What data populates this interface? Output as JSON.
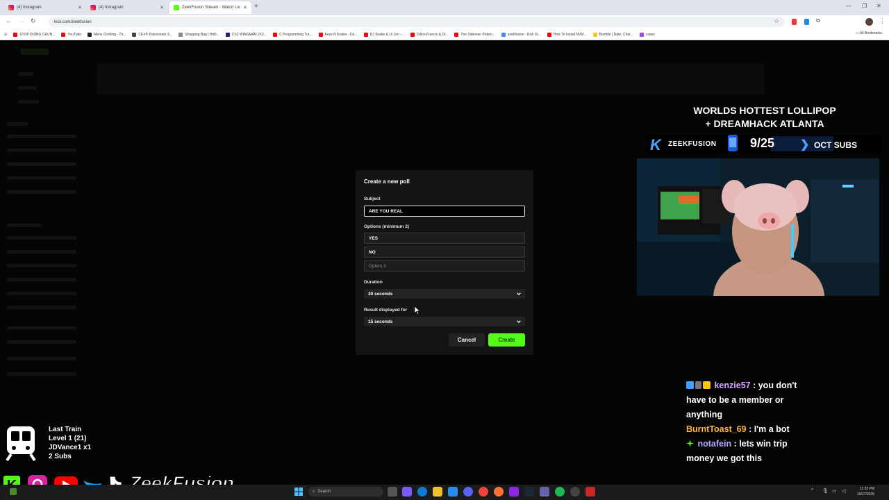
{
  "browser": {
    "tabs": [
      {
        "label": "(4) Instagram",
        "active": false
      },
      {
        "label": "(4) Instagram",
        "active": false
      },
      {
        "label": "ZeekFusion Stream - Watch Liv",
        "active": true
      }
    ],
    "url": "kick.com/zeekfusion",
    "bookmarks": [
      {
        "label": "STOP DOING CRUN...",
        "color": "#ff0000"
      },
      {
        "label": "YouTube",
        "color": "#ff0000"
      },
      {
        "label": "Mens Clothing - Th...",
        "color": "#222222"
      },
      {
        "label": "CEV® Passionate S...",
        "color": "#444444"
      },
      {
        "label": "Shopping Bag | Holli...",
        "color": "#888888"
      },
      {
        "label": "CS2 WINGMAN 2X2...",
        "color": "#1a237e"
      },
      {
        "label": "C Programming Tut...",
        "color": "#ff0000"
      },
      {
        "label": "Keys N Krates - Du...",
        "color": "#ff0000"
      },
      {
        "label": "DJ Snake & Lil Jon -...",
        "color": "#ff0000"
      },
      {
        "label": "Dillon Francis & Di...",
        "color": "#ff0000"
      },
      {
        "label": "The Sidemen Patien...",
        "color": "#ff0000"
      },
      {
        "label": "zeekfusion - Kick St...",
        "color": "#4285f4"
      },
      {
        "label": "How To Install NVM...",
        "color": "#ff0000"
      },
      {
        "label": "Bumble | Date, Chat...",
        "color": "#ffc629"
      },
      {
        "label": "cases",
        "color": "#a142f4"
      }
    ],
    "all_bookmarks": "All Bookmarks"
  },
  "modal": {
    "title": "Create a new poll",
    "subject_label": "Subject",
    "subject_value": "ARE YOU REAL",
    "options_label": "Options (minimum 2)",
    "options": [
      "YES",
      "NO"
    ],
    "option_placeholder": "Option 3",
    "duration_label": "Duration",
    "duration_value": "30 seconds",
    "result_label": "Result displayed for",
    "result_value": "15 seconds",
    "cancel": "Cancel",
    "create": "Create"
  },
  "overlay": {
    "title_line1": "WORLDS HOTTEST LOLLIPOP",
    "title_line2": "+ DREAMHACK ATLANTA",
    "brand": "ZEEKFUSION",
    "date": "9/25",
    "subs": "OCT SUBS"
  },
  "chat": [
    {
      "user": "kenzie57",
      "message": ": you don't have to be a member or anything"
    },
    {
      "user": "BurntToast_69",
      "message": ": I'm a bot"
    },
    {
      "user": "notafein",
      "message": ": lets win trip money we got this"
    }
  ],
  "train": {
    "title": "Last Train",
    "level": "Level 1  (21)",
    "user": "JDVance1 x1",
    "subs": "2 Subs"
  },
  "social": {
    "name": "ZeekFusion"
  },
  "taskbar": {
    "search_placeholder": "Search",
    "time": "11:33 PM",
    "date": "10/27/2025"
  },
  "colors": {
    "kick_green": "#53fc18",
    "modal_bg": "#141414",
    "overlay_blue": "#4da3ff"
  }
}
